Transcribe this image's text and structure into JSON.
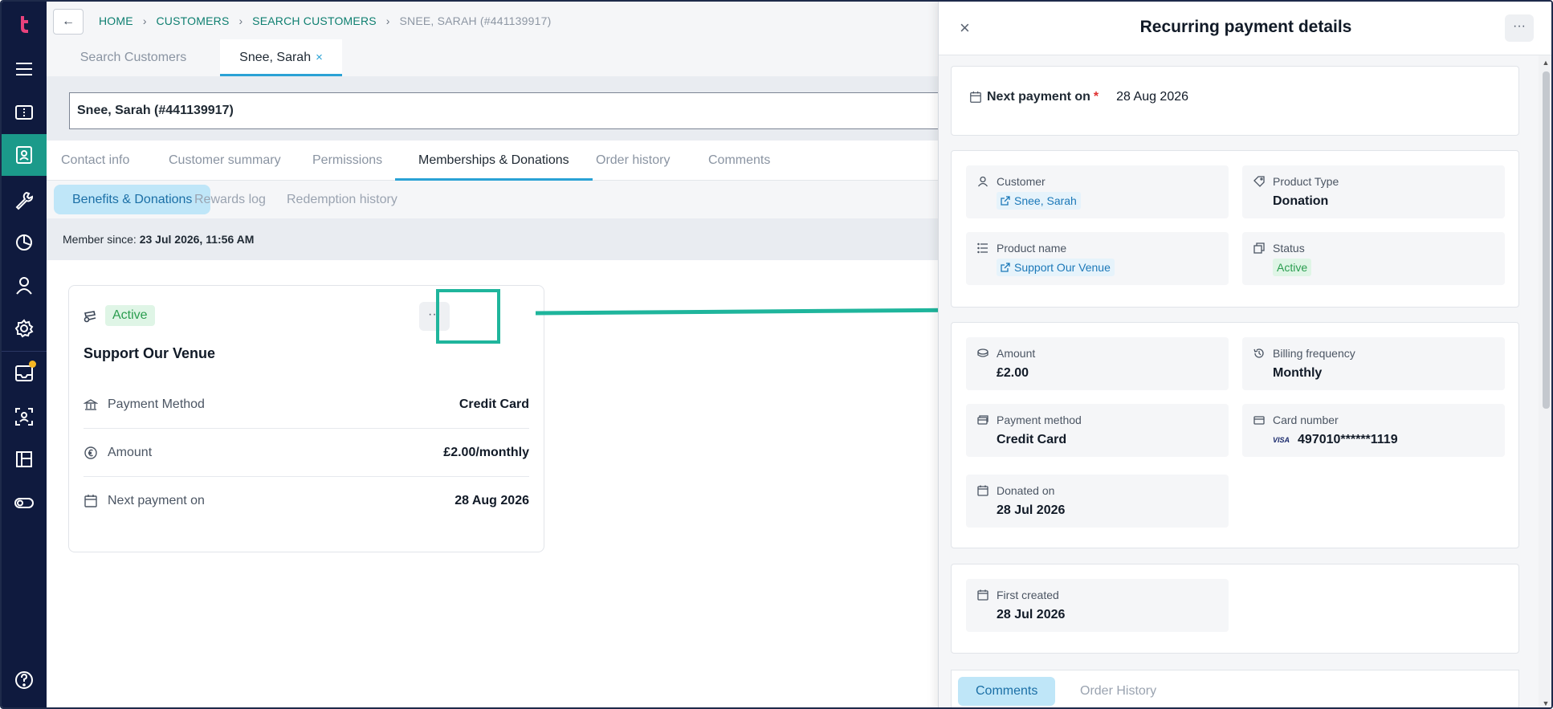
{
  "breadcrumb": {
    "items": [
      "HOME",
      "CUSTOMERS",
      "SEARCH CUSTOMERS"
    ],
    "current": "SNEE, SARAH (#441139917)"
  },
  "main_tabs": {
    "search": "Search Customers",
    "customer": "Snee, Sarah",
    "close_glyph": "×"
  },
  "customer_field": {
    "value": "Snee, Sarah (#441139917)"
  },
  "sub_tabs": [
    "Contact info",
    "Customer summary",
    "Permissions",
    "Memberships & Donations",
    "Order history",
    "Comments"
  ],
  "pills": [
    "Benefits & Donations",
    "Rewards log",
    "Redemption history"
  ],
  "member_since": {
    "label": "Member since:",
    "value": "23 Jul 2026, 11:56 AM"
  },
  "card": {
    "status": "Active",
    "more": "···",
    "title": "Support Our Venue",
    "rows": [
      {
        "label": "Payment Method",
        "value": "Credit Card"
      },
      {
        "label": "Amount",
        "value": "£2.00/monthly"
      },
      {
        "label": "Next payment on",
        "value": "28 Aug 2026"
      }
    ]
  },
  "drawer": {
    "close": "×",
    "title": "Recurring payment details",
    "more": "···",
    "next_payment": {
      "label": "Next payment on",
      "required": "*",
      "value": "28 Aug 2026"
    },
    "customer": {
      "label": "Customer",
      "value": "Snee, Sarah"
    },
    "product_type": {
      "label": "Product Type",
      "value": "Donation"
    },
    "product_name": {
      "label": "Product name",
      "value": "Support Our Venue"
    },
    "status": {
      "label": "Status",
      "value": "Active"
    },
    "amount": {
      "label": "Amount",
      "value": "£2.00"
    },
    "billing_frequency": {
      "label": "Billing frequency",
      "value": "Monthly"
    },
    "payment_method": {
      "label": "Payment method",
      "value": "Credit Card"
    },
    "card_number": {
      "label": "Card number",
      "brand": "VISA",
      "value": "497010******1119"
    },
    "donated_on": {
      "label": "Donated on",
      "value": "28 Jul 2026"
    },
    "first_created": {
      "label": "First created",
      "value": "28 Jul 2026"
    },
    "tabs": [
      "Comments",
      "Order History"
    ]
  },
  "colors": {
    "sidebar": "#0f1a3e",
    "sidebar_active": "#1b9a8a",
    "accent": "#2aa2d5",
    "success": "#2a9d4f",
    "highlight": "#1fb59c"
  }
}
